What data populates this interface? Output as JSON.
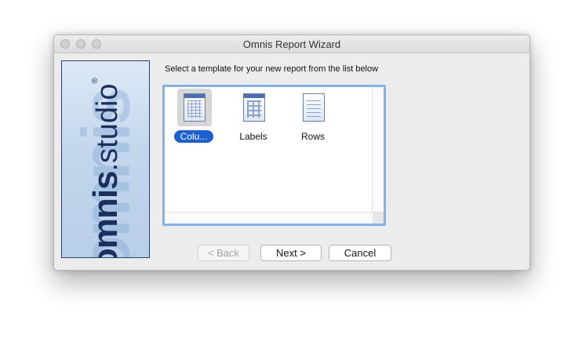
{
  "window": {
    "title": "Omnis Report Wizard"
  },
  "branding": {
    "brand_bold": "omnis",
    "brand_light": ".studio",
    "registered": "®"
  },
  "wizard": {
    "instruction": "Select a template for your new report from the list below",
    "templates": [
      {
        "label": "Colu...",
        "selected": true,
        "icon": "columnar-report-icon"
      },
      {
        "label": "Labels",
        "selected": false,
        "icon": "labels-report-icon"
      },
      {
        "label": "Rows",
        "selected": false,
        "icon": "rows-report-icon"
      }
    ]
  },
  "buttons": {
    "back": "< Back",
    "next": "Next >",
    "cancel": "Cancel"
  },
  "colors": {
    "selection": "#1b5fd1",
    "focus_ring": "#7fb2ef",
    "logo_text": "#1c2f5f"
  }
}
